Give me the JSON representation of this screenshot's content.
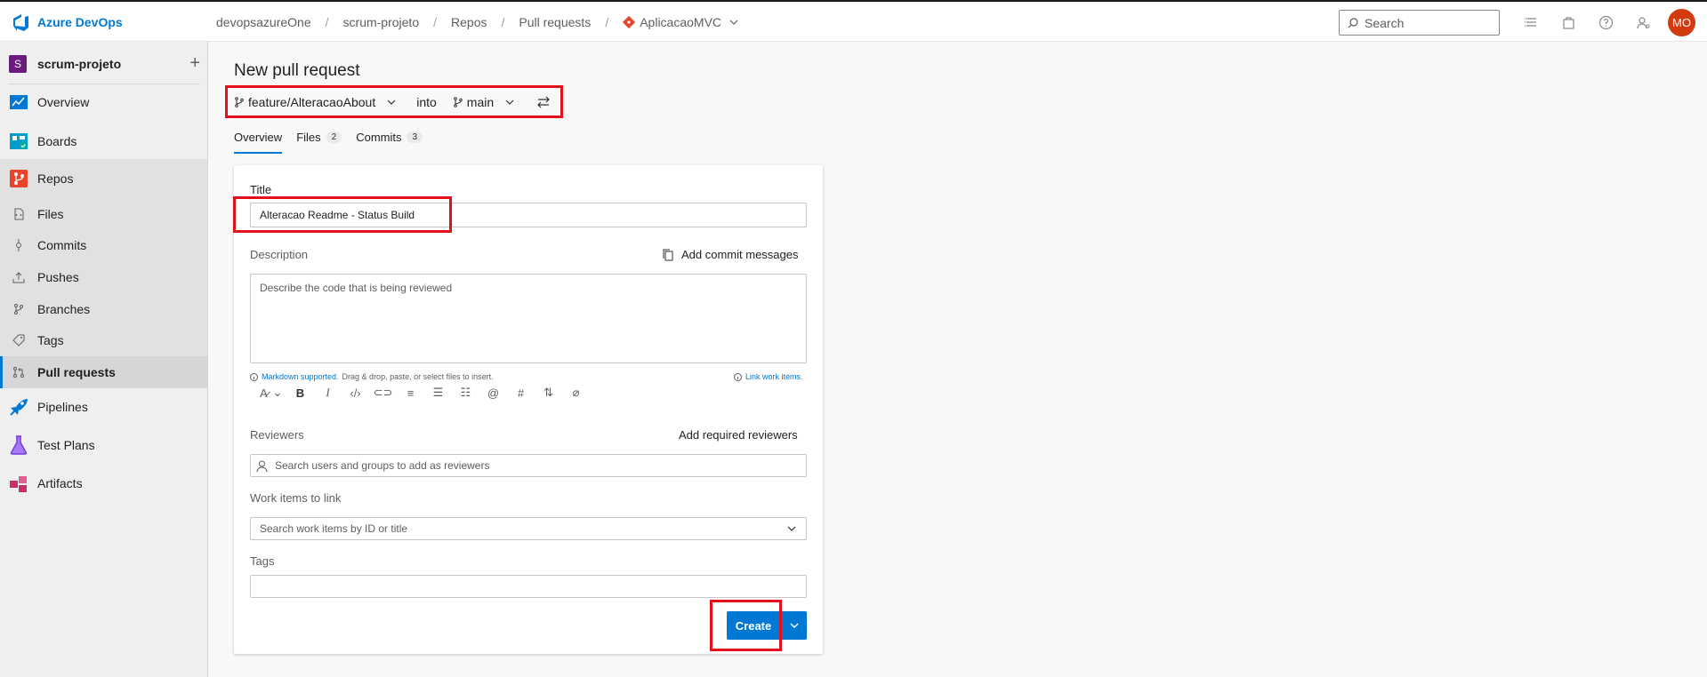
{
  "app": {
    "name": "Azure DevOps"
  },
  "breadcrumb": {
    "org": "devopsazureOne",
    "project": "scrum-projeto",
    "section": "Repos",
    "page": "Pull requests",
    "repo": "AplicacaoMVC"
  },
  "search": {
    "placeholder": "Search"
  },
  "user": {
    "initials": "MO"
  },
  "sidebar": {
    "project_initial": "S",
    "project_name": "scrum-projeto",
    "add": "+",
    "items": [
      {
        "label": "Overview"
      },
      {
        "label": "Boards"
      },
      {
        "label": "Repos"
      },
      {
        "label": "Files"
      },
      {
        "label": "Commits"
      },
      {
        "label": "Pushes"
      },
      {
        "label": "Branches"
      },
      {
        "label": "Tags"
      },
      {
        "label": "Pull requests"
      },
      {
        "label": "Pipelines"
      },
      {
        "label": "Test Plans"
      },
      {
        "label": "Artifacts"
      }
    ]
  },
  "pr": {
    "title": "New pull request",
    "source_branch": "feature/AlteracaoAbout",
    "into": "into",
    "target_branch": "main",
    "tabs": [
      {
        "label": "Overview",
        "count": ""
      },
      {
        "label": "Files",
        "count": "2"
      },
      {
        "label": "Commits",
        "count": "3"
      }
    ],
    "form": {
      "title_label": "Title",
      "title_value": "Alteracao Readme - Status Build",
      "description_label": "Description",
      "add_commit_messages": "Add commit messages",
      "description_placeholder": "Describe the code that is being reviewed",
      "markdown_link": "Markdown supported.",
      "markdown_hint": "Drag & drop, paste, or select files to insert.",
      "link_work_items": "Link work items.",
      "reviewers_label": "Reviewers",
      "add_required_reviewers": "Add required reviewers",
      "reviewers_placeholder": "Search users and groups to add as reviewers",
      "work_items_label": "Work items to link",
      "work_items_placeholder": "Search work items by ID or title",
      "tags_label": "Tags",
      "create": "Create"
    }
  },
  "colors": {
    "accent": "#0078d4",
    "highlight": "#e3101b"
  }
}
